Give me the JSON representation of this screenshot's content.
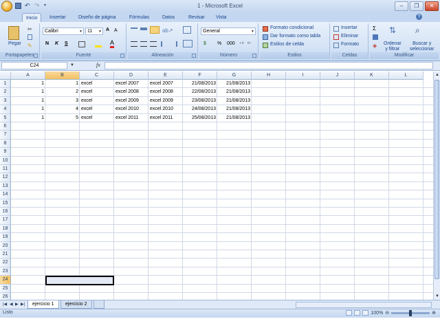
{
  "app": {
    "title": "1 - Microsoft Excel"
  },
  "ribbon_tabs": [
    "Inicio",
    "Insertar",
    "Diseño de página",
    "Fórmulas",
    "Datos",
    "Revisar",
    "Vista"
  ],
  "ribbon": {
    "paste_label": "Pegar",
    "font_name": "Calibri",
    "font_size": "11",
    "number_format": "General",
    "cond_format_label": "Formato condicional",
    "table_format_label": "Dar formato como tabla",
    "cell_styles_label": "Estilos de celda",
    "insert_label": "Insertar",
    "delete_label": "Eliminar",
    "format_label": "Formato",
    "sort_filter_label": "Ordenar y filtrar",
    "find_select_label": "Buscar y seleccionar",
    "sort_line1": "Ordenar",
    "sort_line2": "y filtrar",
    "find_line1": "Buscar y",
    "find_line2": "seleccionar",
    "bold_glyph": "N",
    "italic_glyph": "K",
    "underline_glyph": "S",
    "grow_font_glyph": "A",
    "shrink_font_glyph": "A",
    "sum_glyph": "Σ",
    "percent_glyph": "%",
    "thousands_glyph": "000",
    "currency_glyph": "$",
    "groups": [
      "Portapapeles",
      "Fuente",
      "Alineación",
      "Número",
      "Estilos",
      "Celdas",
      "Modificar"
    ]
  },
  "formula_bar": {
    "name_box": "C24",
    "fx": "fx",
    "value": ""
  },
  "sheet": {
    "columns": [
      "A",
      "B",
      "C",
      "D",
      "E",
      "F",
      "G",
      "H",
      "I",
      "J",
      "K",
      "L"
    ],
    "selected_column": "B",
    "selected_row": "24",
    "rows": [
      "1",
      "2",
      "3",
      "4",
      "5",
      "6",
      "7",
      "8",
      "9",
      "10",
      "11",
      "12",
      "13",
      "14",
      "15",
      "16",
      "17",
      "18",
      "19",
      "20",
      "21",
      "22",
      "23",
      "24",
      "25",
      "26"
    ],
    "data": [
      [
        "1",
        "1",
        "excel",
        "excel 2007",
        "excel 2007",
        "21/08/2013",
        "21/08/2013"
      ],
      [
        "1",
        "2",
        "excel",
        "excel 2008",
        "excel 2008",
        "22/08/2013",
        "21/08/2013"
      ],
      [
        "1",
        "3",
        "excel",
        "excel 2009",
        "excel 2009",
        "23/08/2013",
        "21/08/2013"
      ],
      [
        "1",
        "4",
        "excel",
        "excel 2010",
        "excel 2010",
        "24/08/2013",
        "21/08/2013"
      ],
      [
        "1",
        "5",
        "excel",
        "excel 2011",
        "excel 2011",
        "25/08/2013",
        "21/08/2013"
      ]
    ]
  },
  "sheet_tabs": [
    "ejercicio 1",
    "ejercicio 2"
  ],
  "status": {
    "text": "Listo",
    "zoom": "100%"
  }
}
